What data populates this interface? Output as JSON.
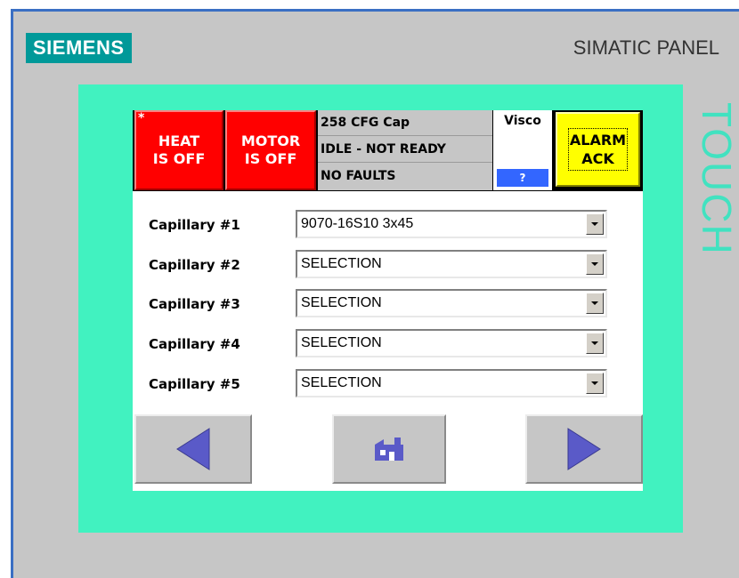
{
  "device": {
    "brand": "SIEMENS",
    "model": "SIMATIC PANEL",
    "side_label": "TOUCH"
  },
  "header": {
    "heat_button": {
      "line1": "HEAT",
      "line2": "IS OFF",
      "marker": "*"
    },
    "motor_button": {
      "line1": "MOTOR",
      "line2": "IS OFF"
    },
    "status": [
      "258 CFG Cap",
      "IDLE - NOT READY",
      "NO FAULTS"
    ],
    "visco": {
      "label": "Visco",
      "help_label": "?"
    },
    "alarm_ack": {
      "line1": "ALARM",
      "line2": "ACK"
    }
  },
  "capillaries": [
    {
      "label": "Capillary #1",
      "value": "9070-16S10 3x45"
    },
    {
      "label": "Capillary #2",
      "value": "SELECTION"
    },
    {
      "label": "Capillary #3",
      "value": "SELECTION"
    },
    {
      "label": "Capillary #4",
      "value": "SELECTION"
    },
    {
      "label": "Capillary #5",
      "value": "SELECTION"
    }
  ],
  "nav": {
    "prev_icon": "triangle-left-icon",
    "home_icon": "factory-icon",
    "next_icon": "triangle-right-icon"
  },
  "colors": {
    "brand": "#009999",
    "bezel": "#41f2c0",
    "alarm_red": "#ff0000",
    "ack_yellow": "#ffff00",
    "nav_arrow": "#5a5ac8"
  }
}
